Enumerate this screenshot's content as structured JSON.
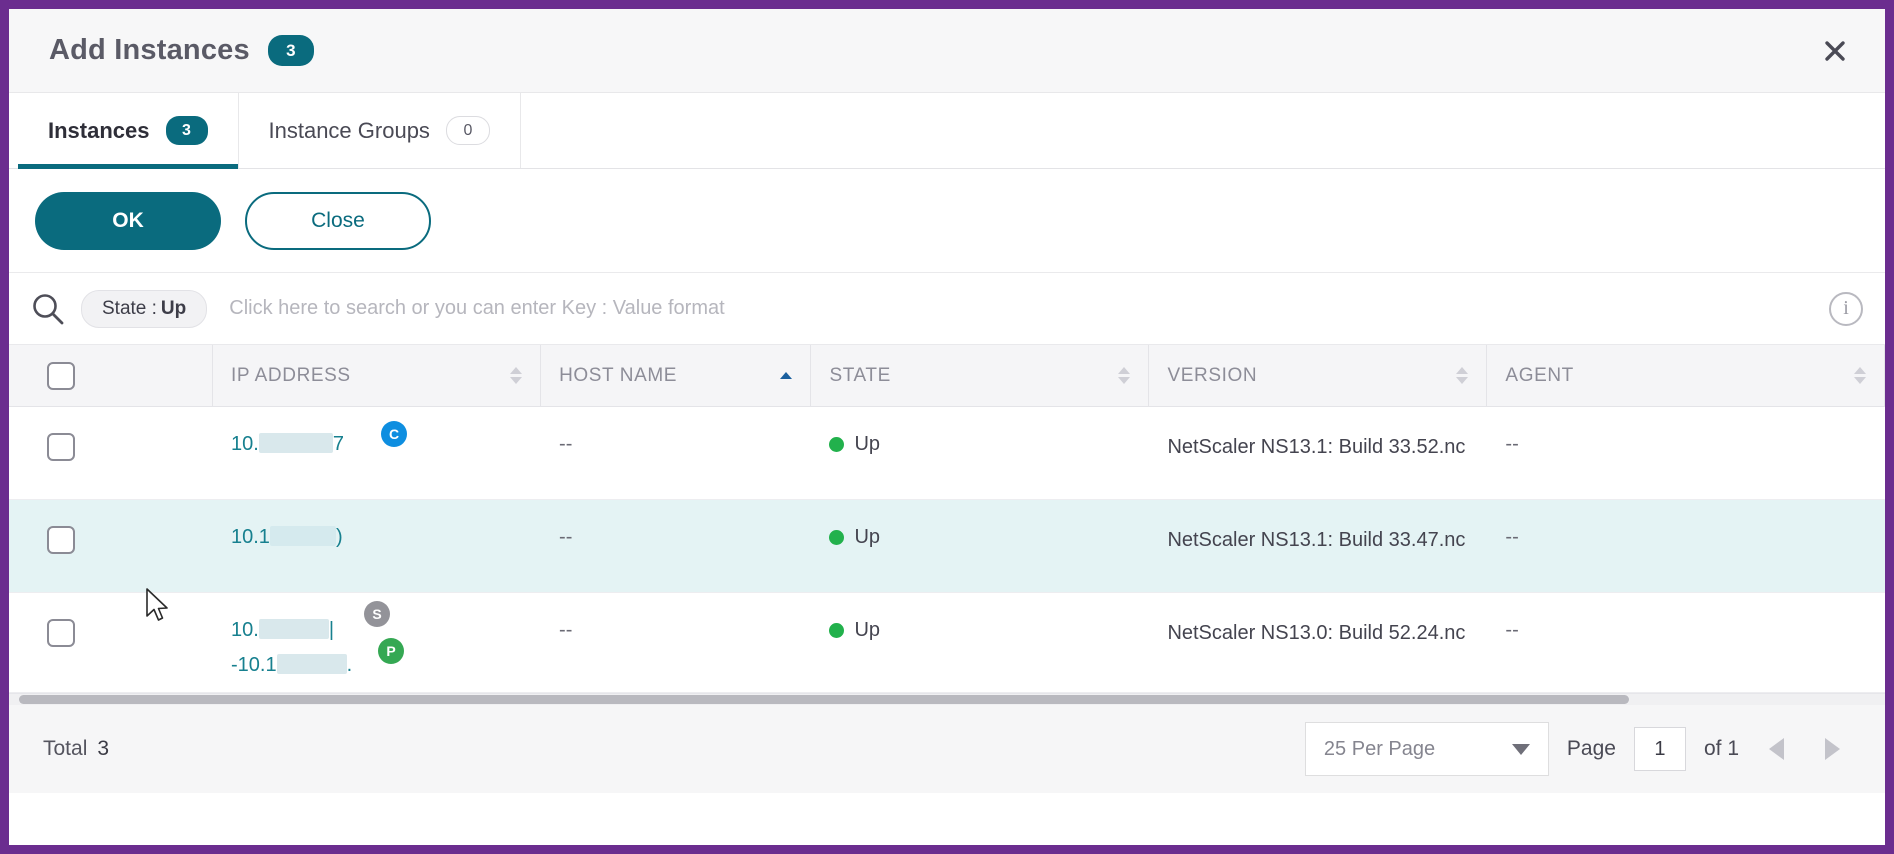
{
  "dialog": {
    "title": "Add Instances",
    "count_badge": "3",
    "close_icon": "close-icon"
  },
  "tabs": [
    {
      "label": "Instances",
      "badge": "3",
      "active": true
    },
    {
      "label": "Instance Groups",
      "badge": "0",
      "active": false
    }
  ],
  "actions": {
    "ok_label": "OK",
    "close_label": "Close"
  },
  "search": {
    "icon": "search-icon",
    "chip_key": "State :",
    "chip_value": "Up",
    "placeholder": "Click here to search or you can enter Key : Value format",
    "info_icon": "info-icon"
  },
  "table": {
    "columns": [
      {
        "key": "select",
        "label": "",
        "sortable": false
      },
      {
        "key": "ip",
        "label": "IP ADDRESS",
        "sortable": true,
        "sorted": false
      },
      {
        "key": "host",
        "label": "HOST NAME",
        "sortable": true,
        "sorted": true,
        "sort_dir": "asc"
      },
      {
        "key": "state",
        "label": "STATE",
        "sortable": true,
        "sorted": false
      },
      {
        "key": "version",
        "label": "VERSION",
        "sortable": true,
        "sorted": false
      },
      {
        "key": "agent",
        "label": "AGENT",
        "sortable": true,
        "sorted": false
      }
    ],
    "rows": [
      {
        "selected": false,
        "hovered": false,
        "ip_lines": [
          {
            "prefix": "10.",
            "redacted": true,
            "suffix": "7",
            "badge": "C",
            "badge_color": "#0e8ee0"
          }
        ],
        "host": "--",
        "state": "Up",
        "state_color": "#22b14c",
        "version": "NetScaler NS13.1: Build 33.52.nc",
        "agent": "--"
      },
      {
        "selected": false,
        "hovered": true,
        "ip_lines": [
          {
            "prefix": "10.1",
            "redacted": true,
            "suffix": ")",
            "badge": "",
            "badge_color": ""
          }
        ],
        "host": "--",
        "state": "Up",
        "state_color": "#22b14c",
        "version": "NetScaler NS13.1: Build 33.47.nc",
        "agent": "--"
      },
      {
        "selected": false,
        "hovered": false,
        "ip_lines": [
          {
            "prefix": "10.",
            "redacted": true,
            "suffix": "|",
            "badge": "S",
            "badge_color": "#939399"
          },
          {
            "prefix": "-10.1",
            "redacted": true,
            "suffix": ".",
            "badge": "P",
            "badge_color": "#35a853"
          }
        ],
        "host": "--",
        "state": "Up",
        "state_color": "#22b14c",
        "version": "NetScaler NS13.0: Build 52.24.nc",
        "agent": "--"
      }
    ]
  },
  "footer": {
    "total_label": "Total",
    "total_value": "3",
    "per_page": "25 Per Page",
    "page_label": "Page",
    "page_value": "1",
    "of_label": "of 1",
    "prev_icon": "arrow-left-icon",
    "next_icon": "arrow-right-icon"
  },
  "theme": {
    "accent": "#0a6b7e",
    "border": "#6b2d8f",
    "link": "#17808f",
    "status_up": "#22b14c",
    "row_hover": "#e4f3f4"
  }
}
